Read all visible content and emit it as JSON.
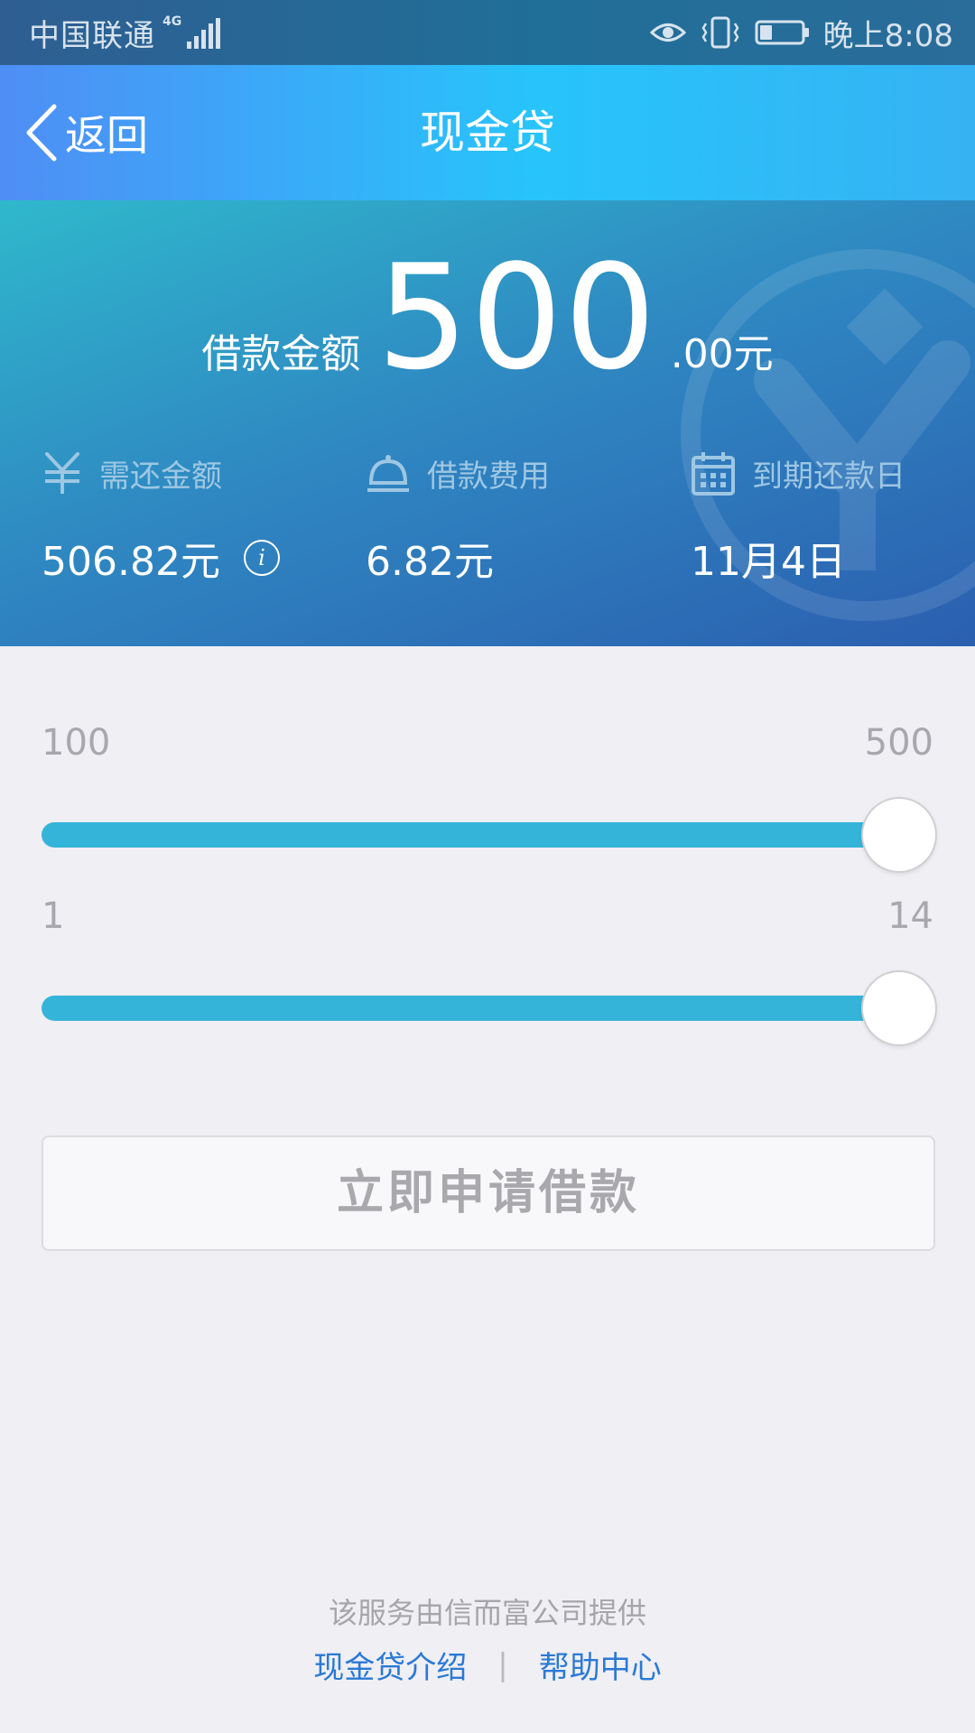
{
  "status_bar": {
    "carrier": "中国联通",
    "network_type": "4G",
    "time": "晚上8:08",
    "icons": [
      "signal-icon",
      "eye-icon",
      "vibrate-icon",
      "battery-icon"
    ],
    "battery_level": 0.3
  },
  "nav": {
    "back_label": "返回",
    "title": "现金贷"
  },
  "loan": {
    "amount_label": "借款金额",
    "amount_value": "500",
    "amount_suffix": ".00元",
    "stats": [
      {
        "icon": "yuan-icon",
        "label": "需还金额",
        "value": "506.82元"
      },
      {
        "icon": "service-bell-icon",
        "label": "借款费用",
        "value": "6.82元"
      },
      {
        "icon": "calendar-icon",
        "label": "到期还款日",
        "value": "11月4日"
      }
    ]
  },
  "sliders": {
    "amount": {
      "min_label": "100",
      "max_label": "500",
      "min": 100,
      "max": 500,
      "value": 500
    },
    "days": {
      "min_label": "1",
      "max_label": "14",
      "min": 1,
      "max": 14,
      "value": 14
    }
  },
  "apply_button": "立即申请借款",
  "footer": {
    "note": "该服务由信而富公司提供",
    "link_intro": "现金贷介绍",
    "separator": "|",
    "link_help": "帮助中心"
  },
  "colors": {
    "accent": "#34b4d8",
    "link": "#2b79d5",
    "hero_start": "#2fb8cc",
    "hero_end": "#2b5fb0"
  }
}
